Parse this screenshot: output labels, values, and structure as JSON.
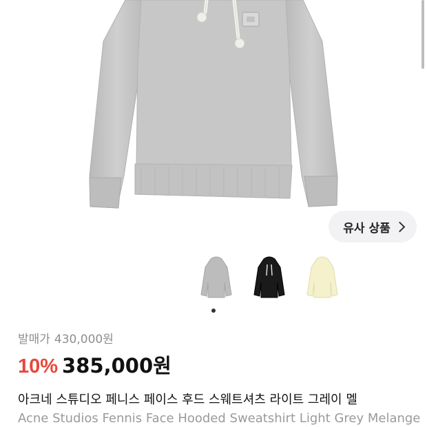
{
  "product": {
    "retail_label": "발매가",
    "retail_price": "430,000원",
    "discount": "10%",
    "price": "385,000원",
    "title_ko": "아크네 스튜디오 페니스 페이스 후드 스웨트셔츠 라이트 그레이 멜",
    "title_en": "Acne Studios Fennis Face Hooded Sweatshirt Light Grey Melange"
  },
  "similar_button": {
    "label": "유사 상품",
    "icon": "chevron-right-icon"
  },
  "thumbnails": [
    {
      "name": "light-grey",
      "color": "#bdbdbd"
    },
    {
      "name": "black",
      "color": "#1a1a1a"
    },
    {
      "name": "pale-yellow",
      "color": "#f3f0c8"
    }
  ],
  "carousel": {
    "active_index": 0,
    "count": 1
  },
  "colors": {
    "discount": "#e8473a",
    "muted_text": "#8e8e93",
    "hoodie_grey": "#c9c9c9"
  }
}
